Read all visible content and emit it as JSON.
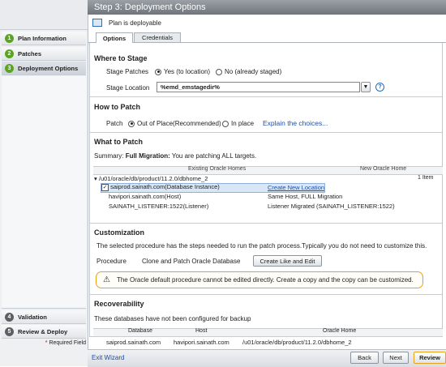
{
  "sidebar": {
    "steps": [
      {
        "num": "1",
        "label": "Plan Information"
      },
      {
        "num": "2",
        "label": "Patches"
      },
      {
        "num": "3",
        "label": "Deployment Options"
      }
    ],
    "bottom_steps": [
      {
        "num": "4",
        "label": "Validation"
      },
      {
        "num": "5",
        "label": "Review & Deploy"
      }
    ],
    "required": "Required Field",
    "required_mark": "*"
  },
  "header": {
    "title": "Step 3: Deployment Options"
  },
  "status": {
    "text": "Plan is deployable"
  },
  "tabs": [
    "Options",
    "Credentials"
  ],
  "where_to_stage": {
    "title": "Where to Stage",
    "stage_patches_label": "Stage Patches",
    "opt_yes": "Yes (to location)",
    "opt_no": "No (already staged)",
    "stage_location_label": "Stage Location",
    "stage_location_value": "%emd_emstagedir%"
  },
  "how_to_patch": {
    "title": "How to Patch",
    "patch_label": "Patch",
    "opt_out": "Out of Place(Recommended)",
    "opt_in": "In place",
    "explain_link": "Explain the choices..."
  },
  "what_to_patch": {
    "title": "What to Patch",
    "summary_prefix": "Summary:",
    "summary_bold": "Full Migration:",
    "summary_text": "You are patching ALL targets.",
    "col_existing": "Existing Oracle Homes",
    "col_new": "New Oracle Home",
    "home_path": "/u01/oracle/db/product/11.2.0/dbhome_2",
    "item_count": "1 Item",
    "rows": [
      {
        "target": "saiprod.sainath.com(Database Instance)",
        "new": "Create New Location"
      },
      {
        "target": "havipori.sainath.com(Host)",
        "new": "Same Host, FULL Migration"
      },
      {
        "target": "SAINATH_LISTENER:1522(Listener)",
        "new": "Listener Migrated (SAINATH_LISTENER:1522)"
      }
    ]
  },
  "customization": {
    "title": "Customization",
    "description": "The selected procedure has the steps needed to run the patch process.Typically you do not need to customize this.",
    "procedure_label": "Procedure",
    "procedure_value": "Clone and Patch Oracle Database",
    "create_button": "Create Like and Edit",
    "warning": "The Oracle default procedure cannot be edited directly. Create a copy and the copy can be customized."
  },
  "recoverability": {
    "title": "Recoverability",
    "note": "These databases have not been configured for backup",
    "headers": [
      "Database",
      "Host",
      "Oracle Home"
    ],
    "row": [
      "saiprod.sainath.com",
      "havipori.sainath.com",
      "/u01/oracle/db/product/11.2.0/dbhome_2"
    ]
  },
  "footer": {
    "exit": "Exit Wizard",
    "back": "Back",
    "next": "Next",
    "review": "Review"
  },
  "colors": {
    "accent": "#e8a21a",
    "step_done": "#5aa323",
    "link": "#1f4fa8"
  }
}
